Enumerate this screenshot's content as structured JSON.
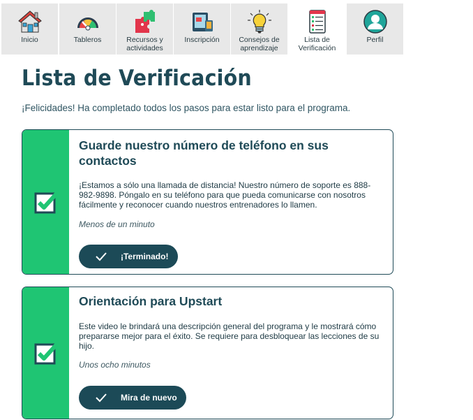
{
  "nav": {
    "tabs": [
      {
        "label": "Inicio",
        "icon": "house-icon"
      },
      {
        "label": "Tableros",
        "icon": "gauge-icon"
      },
      {
        "label": "Recursos y actividades",
        "icon": "puzzle-icon"
      },
      {
        "label": "Inscripción",
        "icon": "tablet-icon"
      },
      {
        "label": "Consejos de aprendizaje",
        "icon": "lightbulb-icon"
      },
      {
        "label": "Lista de Verificación",
        "icon": "checklist-icon",
        "active": true
      },
      {
        "label": "Perfil",
        "icon": "profile-icon"
      }
    ]
  },
  "page": {
    "title": "Lista de Verificación",
    "intro": "¡Felicidades! Ha completado todos los pasos para estar listo para el programa."
  },
  "cards": [
    {
      "title": "Guarde nuestro número de teléfono en sus contactos",
      "description": "¡Estamos a sólo una llamada de distancia! Nuestro número de soporte es 888-982-9898. Póngalo en su teléfono para que pueda comunicarse con nosotros fácilmente y reconocer cuando nuestros entrenadores lo llamen.",
      "time": "Menos de un minuto",
      "button": "¡Terminado!",
      "completed": true
    },
    {
      "title": "Orientación para Upstart",
      "description": "Este video le brindará una descripción general del programa y le mostrará cómo prepararse mejor para el éxito. Se requiere para desbloquear las lecciones de su hijo.",
      "time": "Unos ocho minutos",
      "button": "Mira de nuevo",
      "completed": true
    }
  ],
  "colors": {
    "primary": "#1f4a57",
    "accent_green": "#1fc573",
    "tab_inactive": "#e8e8e8"
  }
}
